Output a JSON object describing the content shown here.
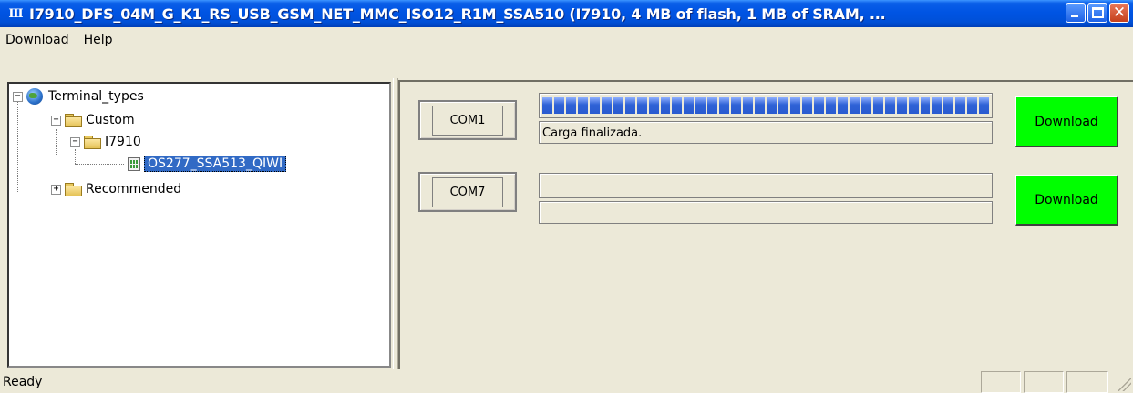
{
  "window": {
    "title": "I7910_DFS_04M_G_K1_RS_USB_GSM_NET_MMC_ISO12_R1M_SSA510 (I7910, 4 MB of flash, 1 MB of SRAM, ...",
    "app_icon_glyph": "III"
  },
  "menu": {
    "download_first": "D",
    "download_rest": "ownload",
    "help_first": "H",
    "help_rest": "elp"
  },
  "tree": {
    "root": "Terminal_types",
    "custom": "Custom",
    "i7910": "I7910",
    "profile": "OS277_SSA513_QIWI",
    "recommended": "Recommended",
    "expand_minus": "−",
    "expand_plus": "+"
  },
  "ports": [
    {
      "name": "COM1",
      "progress_percent": 100,
      "status": "Carga finalizada.",
      "button": "Download",
      "button_color": "#00ff00"
    },
    {
      "name": "COM7",
      "progress_percent": 0,
      "status": "",
      "button": "Download",
      "button_color": "#00ff00"
    }
  ],
  "statusbar": {
    "text": "Ready"
  }
}
